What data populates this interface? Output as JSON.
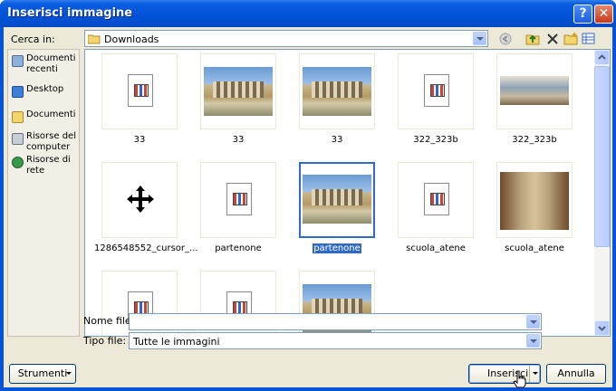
{
  "window": {
    "title": "Inserisci immagine",
    "help_glyph": "?",
    "close_glyph": "✕"
  },
  "lookin": {
    "label": "Cerca in:",
    "value": "Downloads"
  },
  "places": [
    {
      "label": "Documenti recenti",
      "icon": "recent-documents-icon"
    },
    {
      "label": "Desktop",
      "icon": "desktop-icon"
    },
    {
      "label": "Documenti",
      "icon": "my-documents-icon"
    },
    {
      "label": "Risorse del computer",
      "icon": "my-computer-icon"
    },
    {
      "label": "Risorse di rete",
      "icon": "network-places-icon"
    }
  ],
  "files": [
    {
      "name": "33",
      "kind": "generic"
    },
    {
      "name": "33",
      "kind": "temple"
    },
    {
      "name": "33",
      "kind": "temple"
    },
    {
      "name": "322_323b",
      "kind": "generic"
    },
    {
      "name": "322_323b",
      "kind": "fresco2"
    },
    {
      "name": "1286548552_cursor_...",
      "kind": "move"
    },
    {
      "name": "partenone",
      "kind": "generic"
    },
    {
      "name": "partenone",
      "kind": "temple",
      "selected": true
    },
    {
      "name": "scuola_atene",
      "kind": "generic"
    },
    {
      "name": "scuola_atene",
      "kind": "fresco"
    },
    {
      "name": "",
      "kind": "generic"
    },
    {
      "name": "",
      "kind": "generic"
    },
    {
      "name": "",
      "kind": "temple"
    }
  ],
  "filename": {
    "label": "Nome file:",
    "value": ""
  },
  "filetype": {
    "label": "Tipo file:",
    "value": "Tutte le immagini"
  },
  "buttons": {
    "tools": "Strumenti",
    "insert": "Inserisci",
    "cancel": "Annulla"
  },
  "colors": {
    "title_bar": "#0253d8",
    "selection": "#316ac5",
    "dialog_bg": "#ece9d8"
  }
}
